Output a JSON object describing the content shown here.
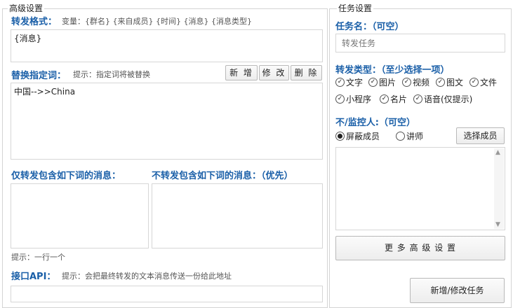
{
  "advanced": {
    "group_title": "高级设置",
    "forward_format": {
      "label": "转发格式：",
      "hint": "变量：{群名}  {来自成员}  {时间}  {消息}  {消息类型}",
      "value": "{消息}"
    },
    "replace": {
      "label": "替换指定词：",
      "hint": "提示：指定词将被替换",
      "add_label": "新 增",
      "edit_label": "修 改",
      "delete_label": "删 除",
      "value": "中国-->>China"
    },
    "include_label": "仅转发包含如下词的消息：",
    "exclude_label": "不转发包含如下词的消息：（优先）",
    "line_hint": "提示：一行一个",
    "api": {
      "label": "接口API：",
      "hint": "提示：会把最终转发的文本消息传送一份给此地址",
      "value": ""
    }
  },
  "task": {
    "group_title": "任务设置",
    "name_label": "任务名：（可空）",
    "name_placeholder": "转发任务",
    "type_label": "转发类型：（至少选择一项）",
    "types": [
      "文字",
      "图片",
      "视频",
      "图文",
      "文件",
      "小程序",
      "名片",
      "语音(仅提示)"
    ],
    "monitor_label": "不/监控人:（可空）",
    "radio_block": "屏蔽成员",
    "radio_lecturer": "讲师",
    "select_member_label": "选择成员",
    "more_settings_label": "更 多 高 级 设 置",
    "submit_label": "新增/修改任务"
  }
}
